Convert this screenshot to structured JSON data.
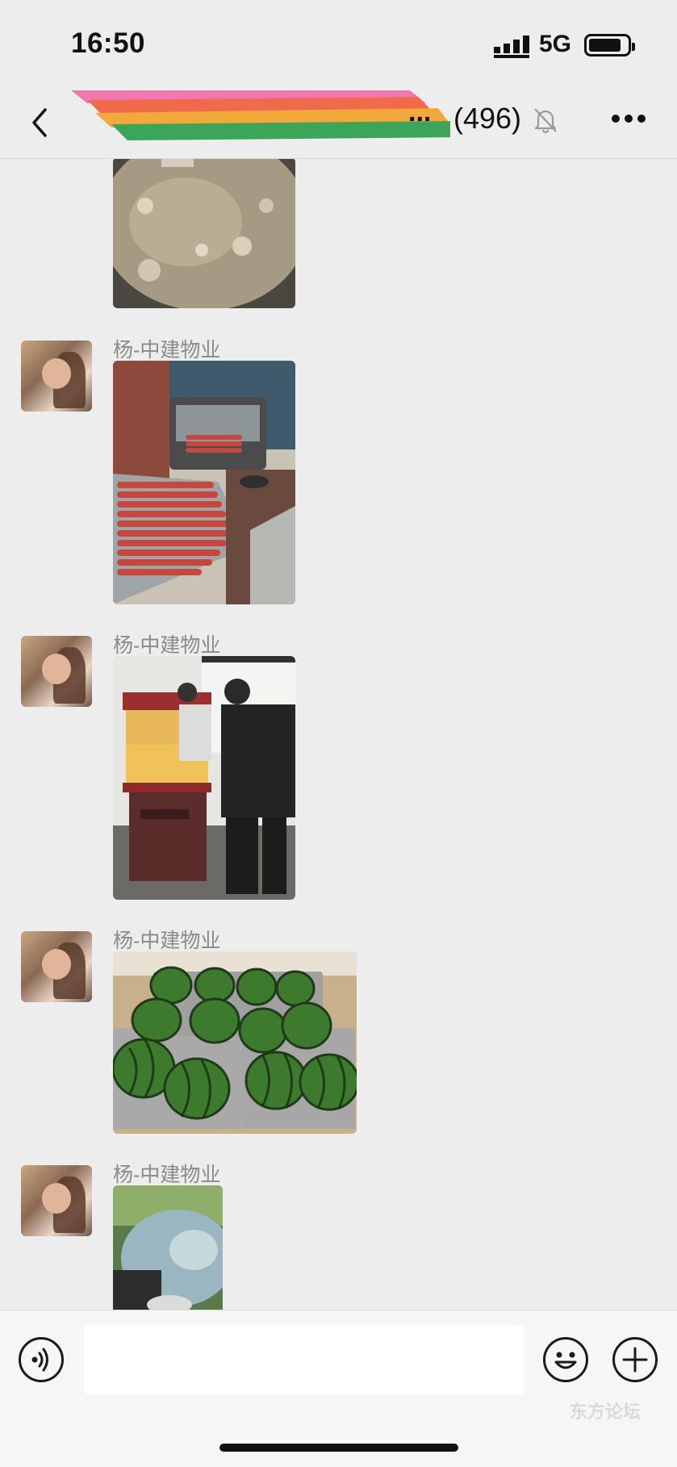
{
  "status_bar": {
    "time": "16:50",
    "network": "5G"
  },
  "nav": {
    "title_suffix": "...",
    "member_count": "(496)"
  },
  "messages": [
    {
      "sender": "杨-中建物业"
    },
    {
      "sender": "杨-中建物业"
    },
    {
      "sender": "杨-中建物业"
    },
    {
      "sender": "杨-中建物业"
    }
  ],
  "input_bar": {
    "placeholder": ""
  },
  "watermark": "东方论坛",
  "icons": {
    "back": "chevron-left-icon",
    "mute": "bell-slash-icon",
    "more": "ellipsis-icon",
    "voice": "voice-icon",
    "emoji": "emoji-icon",
    "add": "plus-icon"
  }
}
